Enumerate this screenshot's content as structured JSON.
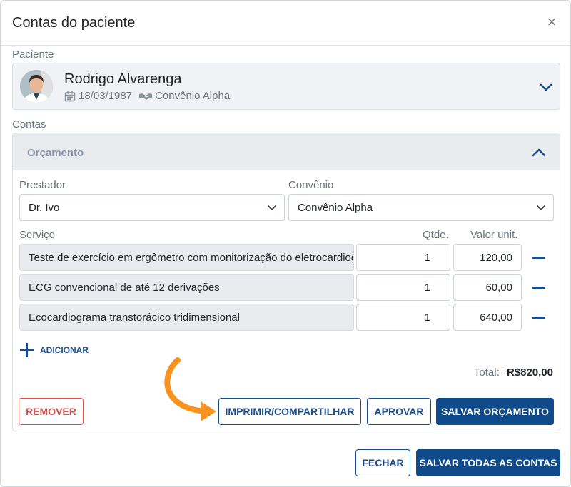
{
  "modal": {
    "title": "Contas do paciente",
    "close_symbol": "×"
  },
  "patient": {
    "section_label": "Paciente",
    "name": "Rodrigo Alvarenga",
    "birth_date": "18/03/1987",
    "insurance": "Convênio Alpha"
  },
  "accounts": {
    "section_label": "Contas",
    "budget": {
      "title": "Orçamento",
      "provider_label": "Prestador",
      "provider_value": "Dr. Ivo",
      "insurance_label": "Convênio",
      "insurance_value": "Convênio Alpha",
      "columns": {
        "service": "Serviço",
        "qty": "Qtde.",
        "unit_price": "Valor unit."
      },
      "services": [
        {
          "name": "Teste de exercício em ergômetro com  monitorização  do eletrocardiograma",
          "qty": "1",
          "price": "120,00"
        },
        {
          "name": "ECG convencional de até 12 derivações",
          "qty": "1",
          "price": "60,00"
        },
        {
          "name": "Ecocardiograma transtorácico tridimensional",
          "qty": "1",
          "price": "640,00"
        }
      ],
      "add_label": "ADICIONAR",
      "total_label": "Total:",
      "total_value": "R$820,00",
      "remove_label": "REMOVER",
      "print_label": "IMPRIMIR/COMPARTILHAR",
      "approve_label": "APROVAR",
      "save_budget_label": "SALVAR ORÇAMENTO"
    }
  },
  "footer": {
    "close_label": "FECHAR",
    "save_all_label": "SALVAR TODAS AS CONTAS"
  },
  "colors": {
    "primary": "#0f4a8a",
    "danger": "#d9534f",
    "annotation_arrow": "#f7931e"
  },
  "icons": [
    "close-icon",
    "calendar-icon",
    "handshake-icon",
    "chevron-down-icon",
    "chevron-up-icon",
    "minus-icon",
    "plus-icon"
  ]
}
